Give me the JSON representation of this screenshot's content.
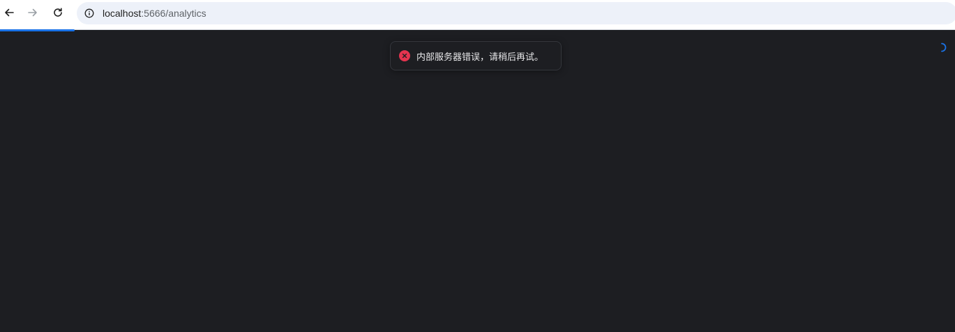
{
  "browser": {
    "url_host": "localhost",
    "url_path": ":5666/analytics",
    "icons": {
      "back": "arrow-left-icon",
      "forward": "arrow-right-icon",
      "reload": "reload-icon",
      "site_info": "info-circle-icon"
    },
    "load_progress": 0.08
  },
  "toast": {
    "type": "error",
    "icon": "close-circle-icon",
    "message": "内部服务器错误，请稍后再试。"
  },
  "spinner": {
    "icon": "loading-spinner-icon"
  },
  "colors": {
    "page_background": "#1d1e22",
    "error": "#e5344f",
    "accent": "#1a73e8",
    "omnibox_background": "#edf1f9"
  }
}
